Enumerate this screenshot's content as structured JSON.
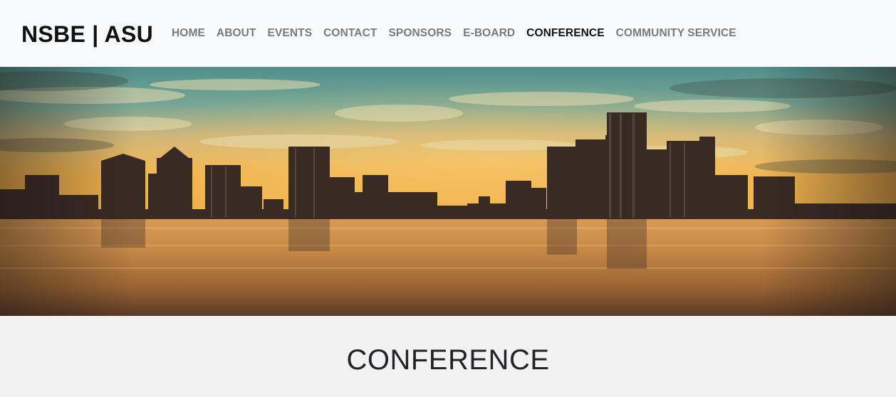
{
  "brand": "NSBE | ASU",
  "nav": {
    "items": [
      {
        "label": "HOME",
        "active": false
      },
      {
        "label": "ABOUT",
        "active": false
      },
      {
        "label": "EVENTS",
        "active": false
      },
      {
        "label": "CONTACT",
        "active": false
      },
      {
        "label": "SPONSORS",
        "active": false
      },
      {
        "label": "E-BOARD",
        "active": false
      },
      {
        "label": "CONFERENCE",
        "active": true
      },
      {
        "label": "COMMUNITY SERVICE",
        "active": false
      }
    ]
  },
  "hero": {
    "image": "city-skyline-waterfront-sunset"
  },
  "section": {
    "title": "CONFERENCE"
  },
  "colors": {
    "nav_bg": "#f8f9fa",
    "nav_link": "#7a7a7a",
    "nav_link_active": "#111111",
    "section_bg": "#f2f2f2",
    "title_text": "#212529"
  }
}
